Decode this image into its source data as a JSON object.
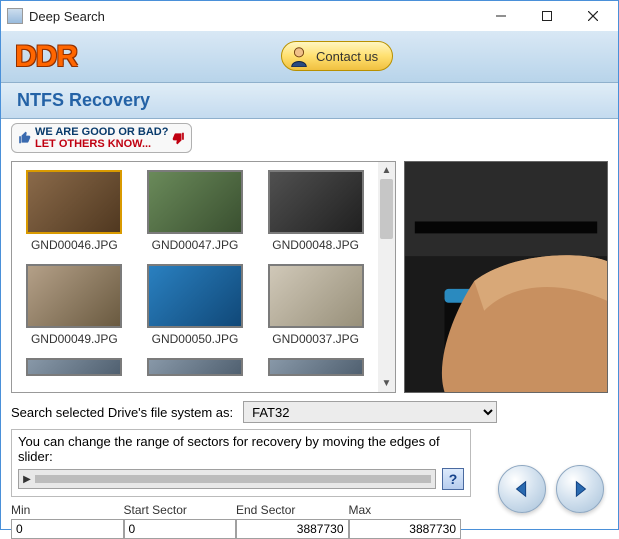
{
  "window": {
    "title": "Deep Search"
  },
  "header": {
    "logo_text": "DDR",
    "contact_label": "Contact us"
  },
  "subheader": {
    "title": "NTFS Recovery"
  },
  "feedback": {
    "line1": "WE ARE GOOD OR BAD?",
    "line2": "LET OTHERS KNOW..."
  },
  "thumbnails": [
    {
      "label": "GND00046.JPG",
      "grad": [
        "#8a6a4a",
        "#503820"
      ]
    },
    {
      "label": "GND00047.JPG",
      "grad": [
        "#6a8a5a",
        "#3a5030"
      ]
    },
    {
      "label": "GND00048.JPG",
      "grad": [
        "#505050",
        "#202020"
      ]
    },
    {
      "label": "GND00049.JPG",
      "grad": [
        "#b4a088",
        "#6a5a40"
      ]
    },
    {
      "label": "GND00050.JPG",
      "grad": [
        "#2a80c0",
        "#104878"
      ]
    },
    {
      "label": "GND00037.JPG",
      "grad": [
        "#d0c8b8",
        "#98907a"
      ]
    }
  ],
  "fs": {
    "label": "Search selected Drive's file system as:",
    "selected": "FAT32"
  },
  "slider": {
    "instruction": "You can change the range of sectors for recovery by moving the edges of slider:",
    "help": "?"
  },
  "sectors": {
    "min": {
      "label": "Min",
      "value": "0"
    },
    "start": {
      "label": "Start Sector",
      "value": "0"
    },
    "end": {
      "label": "End Sector",
      "value": "3887730"
    },
    "max": {
      "label": "Max",
      "value": "3887730"
    }
  }
}
